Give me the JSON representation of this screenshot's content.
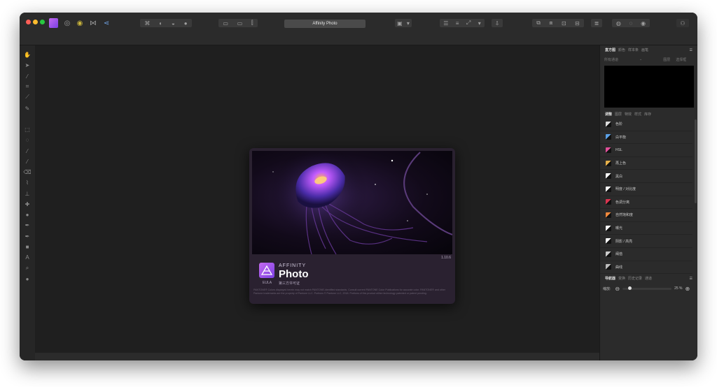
{
  "app": {
    "document_title": "Affinity Photo"
  },
  "splash": {
    "version": "1.10.6",
    "brand": "AFFINITY",
    "product": "Photo",
    "eula_label": "EULA",
    "third_party_label": "第三方许可证",
    "legal_text": "PANTONE® Colors displayed herein may not match PANTONE-identified standards. Consult current PANTONE Color Publications for accurate color. PANTONE® and other Pantone trademarks are the property of Pantone LLC. Portions © Pantone LLC, 2018. Portions of this product utilize technology patented or patent pending."
  },
  "panels": {
    "top_tabs": [
      "直方图",
      "颜色",
      "样本条",
      "画笔"
    ],
    "adjust_tabs": [
      "调整",
      "图层",
      "特效",
      "样式",
      "库存"
    ],
    "nav_tabs": [
      "导航器",
      "变换",
      "历史记录",
      "通道"
    ],
    "histogram": {
      "channel_select": "所有通道",
      "option1": "图层",
      "option2": "选择框"
    },
    "adjustments": [
      {
        "label": "色阶",
        "icon": "levels-icon",
        "color": "#dddddd"
      },
      {
        "label": "白平衡",
        "icon": "white-balance-icon",
        "color": "#5aa0e6"
      },
      {
        "label": "HSL",
        "icon": "hsl-icon",
        "color": "#e04f9a"
      },
      {
        "label": "再上色",
        "icon": "recolor-icon",
        "color": "#e6b04a"
      },
      {
        "label": "黑白",
        "icon": "black-white-icon",
        "color": "#ffffff"
      },
      {
        "label": "明度 / 对比度",
        "icon": "brightness-contrast-icon",
        "color": "#ffffff"
      },
      {
        "label": "色调分离",
        "icon": "posterize-icon",
        "color": "#d9344f"
      },
      {
        "label": "自然饱和度",
        "icon": "vibrance-icon",
        "color": "#f0883c"
      },
      {
        "label": "曝光",
        "icon": "exposure-icon",
        "color": "#ffffff"
      },
      {
        "label": "阴影 / 高亮",
        "icon": "shadows-highlights-icon",
        "color": "#ffffff"
      },
      {
        "label": "阈值",
        "icon": "threshold-icon",
        "color": "#cccccc"
      },
      {
        "label": "曲线",
        "icon": "curves-icon",
        "color": "#bbbbbb"
      }
    ],
    "navigator": {
      "zoom_label": "缩放:",
      "zoom_value": "25 %"
    }
  }
}
